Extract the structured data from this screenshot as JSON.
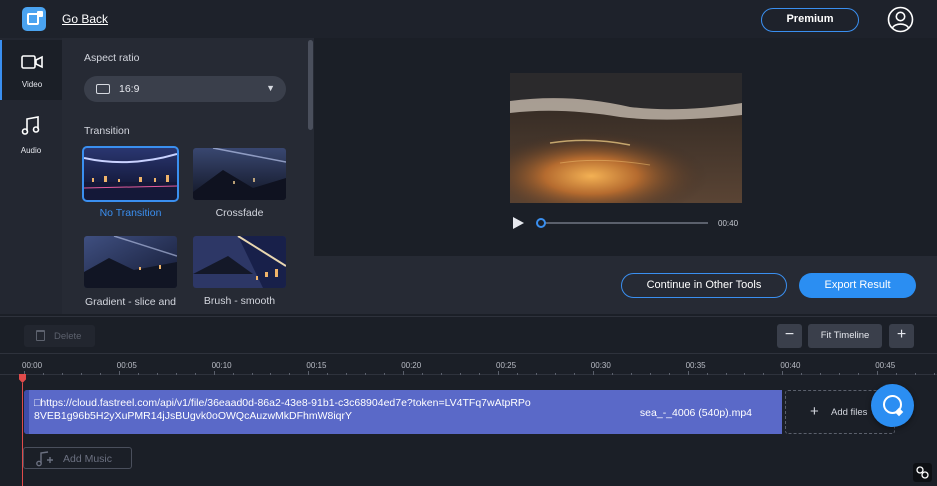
{
  "header": {
    "go_back": "Go Back",
    "premium": "Premium",
    "logo_icon": "app-logo-icon",
    "account_icon": "user-circle-icon"
  },
  "nav": {
    "items": [
      {
        "label": "Video",
        "icon": "video-camera-icon"
      },
      {
        "label": "Audio",
        "icon": "music-note-icon"
      }
    ]
  },
  "panel": {
    "aspect_title": "Aspect ratio",
    "aspect_value": "16:9",
    "transition_title": "Transition",
    "transitions": [
      {
        "label": "No Transition",
        "selected": true
      },
      {
        "label": "Crossfade",
        "selected": false
      },
      {
        "label": "Gradient - slice and",
        "selected": false
      },
      {
        "label": "Brush - smooth",
        "selected": false
      }
    ]
  },
  "player": {
    "duration": "00:40",
    "progress": 0.0
  },
  "actions": {
    "continue": "Continue in Other Tools",
    "export": "Export Result"
  },
  "timeline": {
    "delete": "Delete",
    "fit": "Fit Timeline",
    "zoom_out": "−",
    "zoom_in": "+",
    "ticks": [
      "00:00",
      "00:05",
      "00:10",
      "00:15",
      "00:20",
      "00:25",
      "00:30",
      "00:35",
      "00:40",
      "00:45"
    ],
    "clip_url": "https://cloud.fastreel.com/api/v1/file/36eaad0d-86a2-43e8-91b1-c3c68904ed7e?token=LV4TFq7wAtpRPo8VEB1g96b5H2yXuPMR14jJsBUgvk0oOWQcAuzwMkDFhmW8iqrY",
    "clip_name": "sea_-_4006 (540p).mp4",
    "add_files": "Add files",
    "add_music": "Add Music"
  },
  "colors": {
    "accent": "#3a8ff0",
    "playhead": "#e04b4b",
    "clip": "#5a69c8"
  }
}
